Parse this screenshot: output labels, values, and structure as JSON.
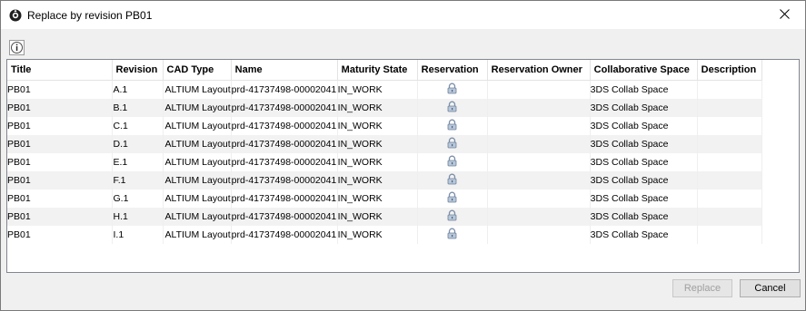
{
  "window": {
    "title": "Replace by revision PB01",
    "app_icon": "catia-icon",
    "close_icon": "close-icon"
  },
  "toolbar": {
    "info_icon": "info-icon"
  },
  "table": {
    "columns": [
      "Title",
      "Revision",
      "CAD Type",
      "Name",
      "Maturity State",
      "Reservation",
      "Reservation Owner",
      "Collaborative Space",
      "Description"
    ],
    "rows": [
      {
        "title": "PB01",
        "revision": "A.1",
        "cad_type": "ALTIUM Layout",
        "name": "prd-41737498-00002041",
        "maturity": "IN_WORK",
        "reservation_icon": "lock-icon",
        "owner": "",
        "space": "3DS Collab Space",
        "description": ""
      },
      {
        "title": "PB01",
        "revision": "B.1",
        "cad_type": "ALTIUM Layout",
        "name": "prd-41737498-00002041",
        "maturity": "IN_WORK",
        "reservation_icon": "lock-icon",
        "owner": "",
        "space": "3DS Collab Space",
        "description": ""
      },
      {
        "title": "PB01",
        "revision": "C.1",
        "cad_type": "ALTIUM Layout",
        "name": "prd-41737498-00002041",
        "maturity": "IN_WORK",
        "reservation_icon": "lock-icon",
        "owner": "",
        "space": "3DS Collab Space",
        "description": ""
      },
      {
        "title": "PB01",
        "revision": "D.1",
        "cad_type": "ALTIUM Layout",
        "name": "prd-41737498-00002041",
        "maturity": "IN_WORK",
        "reservation_icon": "lock-icon",
        "owner": "",
        "space": "3DS Collab Space",
        "description": ""
      },
      {
        "title": "PB01",
        "revision": "E.1",
        "cad_type": "ALTIUM Layout",
        "name": "prd-41737498-00002041",
        "maturity": "IN_WORK",
        "reservation_icon": "lock-icon",
        "owner": "",
        "space": "3DS Collab Space",
        "description": ""
      },
      {
        "title": "PB01",
        "revision": "F.1",
        "cad_type": "ALTIUM Layout",
        "name": "prd-41737498-00002041",
        "maturity": "IN_WORK",
        "reservation_icon": "lock-icon",
        "owner": "",
        "space": "3DS Collab Space",
        "description": ""
      },
      {
        "title": "PB01",
        "revision": "G.1",
        "cad_type": "ALTIUM Layout",
        "name": "prd-41737498-00002041",
        "maturity": "IN_WORK",
        "reservation_icon": "lock-icon",
        "owner": "",
        "space": "3DS Collab Space",
        "description": ""
      },
      {
        "title": "PB01",
        "revision": "H.1",
        "cad_type": "ALTIUM Layout",
        "name": "prd-41737498-00002041",
        "maturity": "IN_WORK",
        "reservation_icon": "lock-icon",
        "owner": "",
        "space": "3DS Collab Space",
        "description": ""
      },
      {
        "title": "PB01",
        "revision": "I.1",
        "cad_type": "ALTIUM Layout",
        "name": "prd-41737498-00002041",
        "maturity": "IN_WORK",
        "reservation_icon": "lock-icon",
        "owner": "",
        "space": "3DS Collab Space",
        "description": ""
      }
    ]
  },
  "buttons": {
    "replace_label": "Replace",
    "replace_enabled": false,
    "cancel_label": "Cancel"
  }
}
